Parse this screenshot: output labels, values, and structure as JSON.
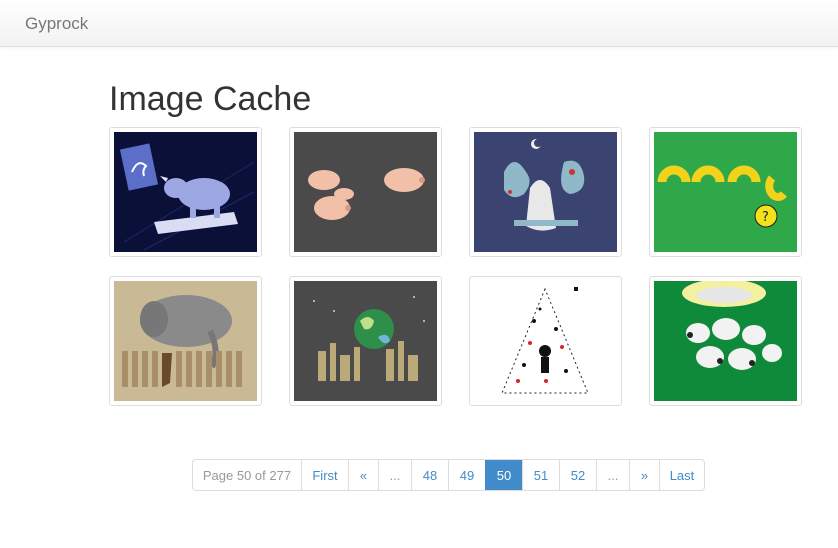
{
  "navbar": {
    "brand": "Gyprock"
  },
  "page": {
    "title": "Image Cache"
  },
  "gallery": [
    {
      "icon": "thumbnail-rhino-treadmill",
      "bg": "#0b1038"
    },
    {
      "icon": "thumbnail-pigs",
      "bg": "#4a4a4a"
    },
    {
      "icon": "thumbnail-night-forest-creatures",
      "bg": "#3b4470"
    },
    {
      "icon": "thumbnail-macaroni-question",
      "bg": "#2fa84a"
    },
    {
      "icon": "thumbnail-elephant-fence",
      "bg": "#c9b995"
    },
    {
      "icon": "thumbnail-earth-city",
      "bg": "#4a4a4a"
    },
    {
      "icon": "thumbnail-christmas-tree",
      "bg": "#ffffff"
    },
    {
      "icon": "thumbnail-sheep-flock",
      "bg": "#0f8a3a"
    }
  ],
  "pagination": {
    "info": "Page 50 of 277",
    "first": "First",
    "prev": "«",
    "ellipsis_left": "...",
    "pages": [
      "48",
      "49",
      "50",
      "51",
      "52"
    ],
    "current": "50",
    "ellipsis_right": "...",
    "next": "»",
    "last": "Last"
  },
  "colors": {
    "accent": "#428bca",
    "border": "#dddddd"
  }
}
